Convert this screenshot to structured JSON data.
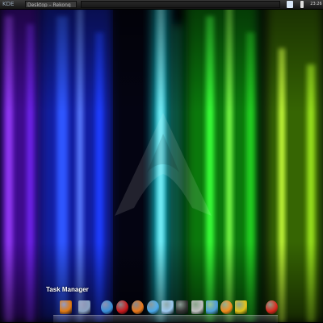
{
  "taskbar": {
    "app_menu_label": "KDE",
    "task_label": "Desktop – Rekonq",
    "clock": "23:26"
  },
  "desktop": {
    "wallpaper": "aurora-arch",
    "colors": {
      "violet": "#7a1fd6",
      "blue": "#1f3cff",
      "cyan": "#1fd8d8",
      "green": "#1ce81c",
      "lime": "#b4ff2a"
    }
  },
  "dock": {
    "tooltip": "Task Manager",
    "items": [
      {
        "icon": "task-manager-icon",
        "color": "#e07a12"
      },
      {
        "icon": "terminal-icon",
        "color": "#8aa2c2"
      },
      {
        "icon": "globe-icon",
        "color": "#3a8fd8"
      },
      {
        "icon": "opera-icon",
        "color": "#c8181c"
      },
      {
        "icon": "firefox-icon",
        "color": "#e8771a"
      },
      {
        "icon": "network-icon",
        "color": "#4aa8e8"
      },
      {
        "icon": "file-manager-icon",
        "color": "#9cc8ee"
      },
      {
        "icon": "system-monitor-icon",
        "color": "#333333"
      },
      {
        "icon": "calculator-icon",
        "color": "#bfbfbf"
      },
      {
        "icon": "image-viewer-icon",
        "color": "#4fa0d8"
      },
      {
        "icon": "blender-icon",
        "color": "#f08a1c"
      },
      {
        "icon": "colors-icon",
        "color": "#e0c21a"
      },
      {
        "icon": "shutdown-icon",
        "color": "#d8281c"
      }
    ]
  }
}
